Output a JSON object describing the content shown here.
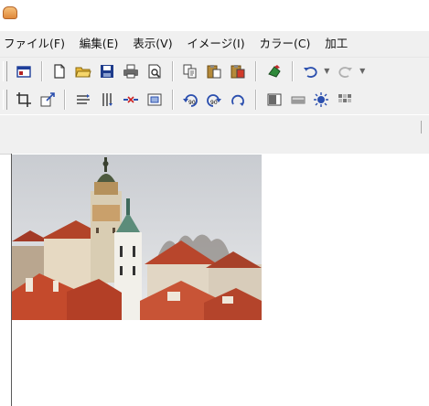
{
  "menubar": {
    "items": [
      {
        "label": "ファイル(F)"
      },
      {
        "label": "編集(E)"
      },
      {
        "label": "表示(V)"
      },
      {
        "label": "イメージ(I)"
      },
      {
        "label": "カラー(C)"
      },
      {
        "label": "加工"
      }
    ]
  },
  "toolbar1": {
    "icons": [
      "open-window-icon",
      "new-file-icon",
      "open-folder-icon",
      "save-icon",
      "print-icon",
      "print-preview-icon",
      "copy-icon",
      "paste-icon",
      "paste-special-icon",
      "scan-icon",
      "undo-icon",
      "redo-icon"
    ]
  },
  "toolbar2": {
    "icons": [
      "crop-icon",
      "resize-icon",
      "flip-horizontal-icon",
      "flip-vertical-icon",
      "trim-icon",
      "frame-icon",
      "rotate-90-left-icon",
      "rotate-90-right-icon",
      "rotate-180-icon",
      "brightness-icon",
      "contrast-icon",
      "sharpen-icon",
      "mosaic-icon"
    ]
  },
  "canvas": {
    "image_subject": "castle-town-photo"
  },
  "colors": {
    "chrome": "#f0f0f0",
    "accent": "#d9462b"
  }
}
